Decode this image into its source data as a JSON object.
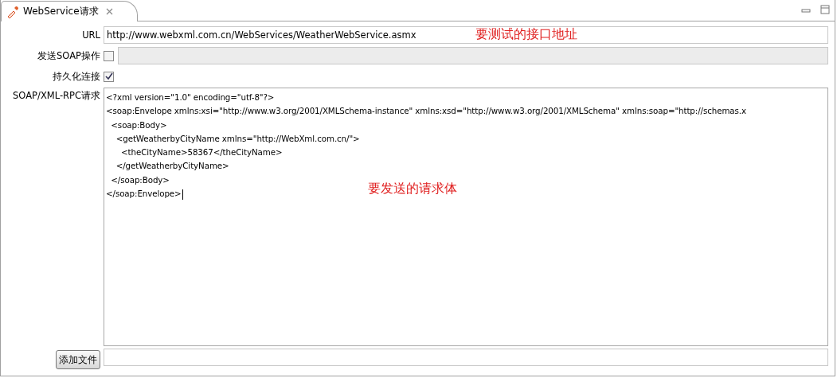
{
  "tab": {
    "title": "WebService请求",
    "selected": true
  },
  "form": {
    "url": {
      "label": "URL",
      "value": "http://www.webxml.com.cn/WebServices/WeatherWebService.asmx",
      "note": "要测试的接口地址"
    },
    "soap_action": {
      "label": "发送SOAP操作",
      "checked": false,
      "disabled": true
    },
    "keep_alive": {
      "label": "持久化连接",
      "checked": true
    },
    "body": {
      "label": "SOAP/XML-RPC请求",
      "lines": [
        "<?xml version=\"1.0\" encoding=\"utf-8\"?>",
        "<soap:Envelope xmlns:xsi=\"http://www.w3.org/2001/XMLSchema-instance\" xmlns:xsd=\"http://www.w3.org/2001/XMLSchema\" xmlns:soap=\"http://schemas.x",
        "  <soap:Body>",
        "    <getWeatherbyCityName xmlns=\"http://WebXml.com.cn/\">",
        "      <theCityName>58367</theCityName>",
        "    </getWeatherbyCityName>",
        "  </soap:Body>",
        "</soap:Envelope>"
      ],
      "note": "要发送的请求体"
    },
    "add_file": {
      "button": "添加文件"
    }
  }
}
